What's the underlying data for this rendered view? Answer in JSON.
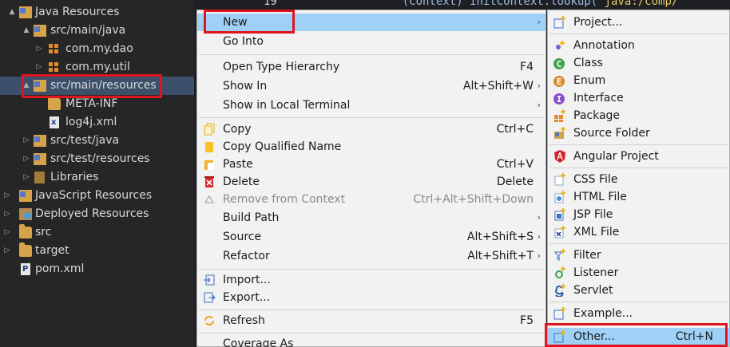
{
  "editor": {
    "line_number": "19",
    "code_segments": [
      "(Context) initContext.lookup(",
      "\"java:/comp/"
    ]
  },
  "tree": {
    "items": [
      {
        "label": "Java Resources",
        "icon": "java-resources-icon",
        "twisty": "▲"
      },
      {
        "label": "src/main/java",
        "icon": "source-folder-icon",
        "twisty": "▲"
      },
      {
        "label": "com.my.dao",
        "icon": "package-icon",
        "twisty": "▷"
      },
      {
        "label": "com.my.util",
        "icon": "package-icon",
        "twisty": "▷"
      },
      {
        "label": "src/main/resources",
        "icon": "source-folder-icon",
        "twisty": "▲"
      },
      {
        "label": "META-INF",
        "icon": "folder-icon",
        "twisty": ""
      },
      {
        "label": "log4j.xml",
        "icon": "xml-file-icon",
        "twisty": ""
      },
      {
        "label": "src/test/java",
        "icon": "source-folder-icon",
        "twisty": "▷"
      },
      {
        "label": "src/test/resources",
        "icon": "source-folder-icon",
        "twisty": "▷"
      },
      {
        "label": "Libraries",
        "icon": "library-icon",
        "twisty": "▷"
      },
      {
        "label": "JavaScript Resources",
        "icon": "javascript-resources-icon",
        "twisty": "▷"
      },
      {
        "label": "Deployed Resources",
        "icon": "deployed-resources-icon",
        "twisty": "▷"
      },
      {
        "label": "src",
        "icon": "folder-icon",
        "twisty": "▷"
      },
      {
        "label": "target",
        "icon": "folder-icon",
        "twisty": "▷"
      },
      {
        "label": "pom.xml",
        "icon": "pom-file-icon",
        "twisty": ""
      }
    ]
  },
  "menu": {
    "items": [
      {
        "label": "New",
        "shortcut": "",
        "submenu": true,
        "icon": ""
      },
      {
        "label": "Go Into",
        "shortcut": "",
        "submenu": false,
        "icon": ""
      },
      {
        "label": "Open Type Hierarchy",
        "shortcut": "F4",
        "submenu": false,
        "icon": ""
      },
      {
        "label": "Show In",
        "shortcut": "Alt+Shift+W",
        "submenu": true,
        "icon": ""
      },
      {
        "label": "Show in Local Terminal",
        "shortcut": "",
        "submenu": true,
        "icon": ""
      },
      {
        "label": "Copy",
        "shortcut": "Ctrl+C",
        "submenu": false,
        "icon": "copy-icon"
      },
      {
        "label": "Copy Qualified Name",
        "shortcut": "",
        "submenu": false,
        "icon": "copy-qualified-name-icon"
      },
      {
        "label": "Paste",
        "shortcut": "Ctrl+V",
        "submenu": false,
        "icon": "paste-icon"
      },
      {
        "label": "Delete",
        "shortcut": "Delete",
        "submenu": false,
        "icon": "delete-icon"
      },
      {
        "label": "Remove from Context",
        "shortcut": "Ctrl+Alt+Shift+Down",
        "submenu": false,
        "icon": "remove-context-icon"
      },
      {
        "label": "Build Path",
        "shortcut": "",
        "submenu": true,
        "icon": ""
      },
      {
        "label": "Source",
        "shortcut": "Alt+Shift+S",
        "submenu": true,
        "icon": ""
      },
      {
        "label": "Refactor",
        "shortcut": "Alt+Shift+T",
        "submenu": true,
        "icon": ""
      },
      {
        "label": "Import...",
        "shortcut": "",
        "submenu": false,
        "icon": "import-icon"
      },
      {
        "label": "Export...",
        "shortcut": "",
        "submenu": false,
        "icon": "export-icon"
      },
      {
        "label": "Refresh",
        "shortcut": "F5",
        "submenu": false,
        "icon": "refresh-icon"
      },
      {
        "label": "Coverage As",
        "shortcut": "",
        "submenu": false,
        "icon": ""
      }
    ]
  },
  "submenu": {
    "items": [
      {
        "label": "Project...",
        "shortcut": "",
        "icon": "new-project-icon"
      },
      {
        "label": "Annotation",
        "shortcut": "",
        "icon": "annotation-icon"
      },
      {
        "label": "Class",
        "shortcut": "",
        "icon": "class-icon"
      },
      {
        "label": "Enum",
        "shortcut": "",
        "icon": "enum-icon"
      },
      {
        "label": "Interface",
        "shortcut": "",
        "icon": "interface-icon"
      },
      {
        "label": "Package",
        "shortcut": "",
        "icon": "package-icon"
      },
      {
        "label": "Source Folder",
        "shortcut": "",
        "icon": "source-folder-icon"
      },
      {
        "label": "Angular Project",
        "shortcut": "",
        "icon": "angular-icon"
      },
      {
        "label": "CSS File",
        "shortcut": "",
        "icon": "css-file-icon"
      },
      {
        "label": "HTML File",
        "shortcut": "",
        "icon": "html-file-icon"
      },
      {
        "label": "JSP File",
        "shortcut": "",
        "icon": "jsp-file-icon"
      },
      {
        "label": "XML File",
        "shortcut": "",
        "icon": "xml-file-icon"
      },
      {
        "label": "Filter",
        "shortcut": "",
        "icon": "filter-icon"
      },
      {
        "label": "Listener",
        "shortcut": "",
        "icon": "listener-icon"
      },
      {
        "label": "Servlet",
        "shortcut": "",
        "icon": "servlet-icon"
      },
      {
        "label": "Example...",
        "shortcut": "",
        "icon": "example-icon"
      },
      {
        "label": "Other...",
        "shortcut": "Ctrl+N",
        "icon": "other-icon"
      }
    ]
  },
  "colors": {
    "highlight": "#9fd0f5",
    "annotation_box": "#e0141e",
    "tree_selection": "#3c4f6b"
  }
}
